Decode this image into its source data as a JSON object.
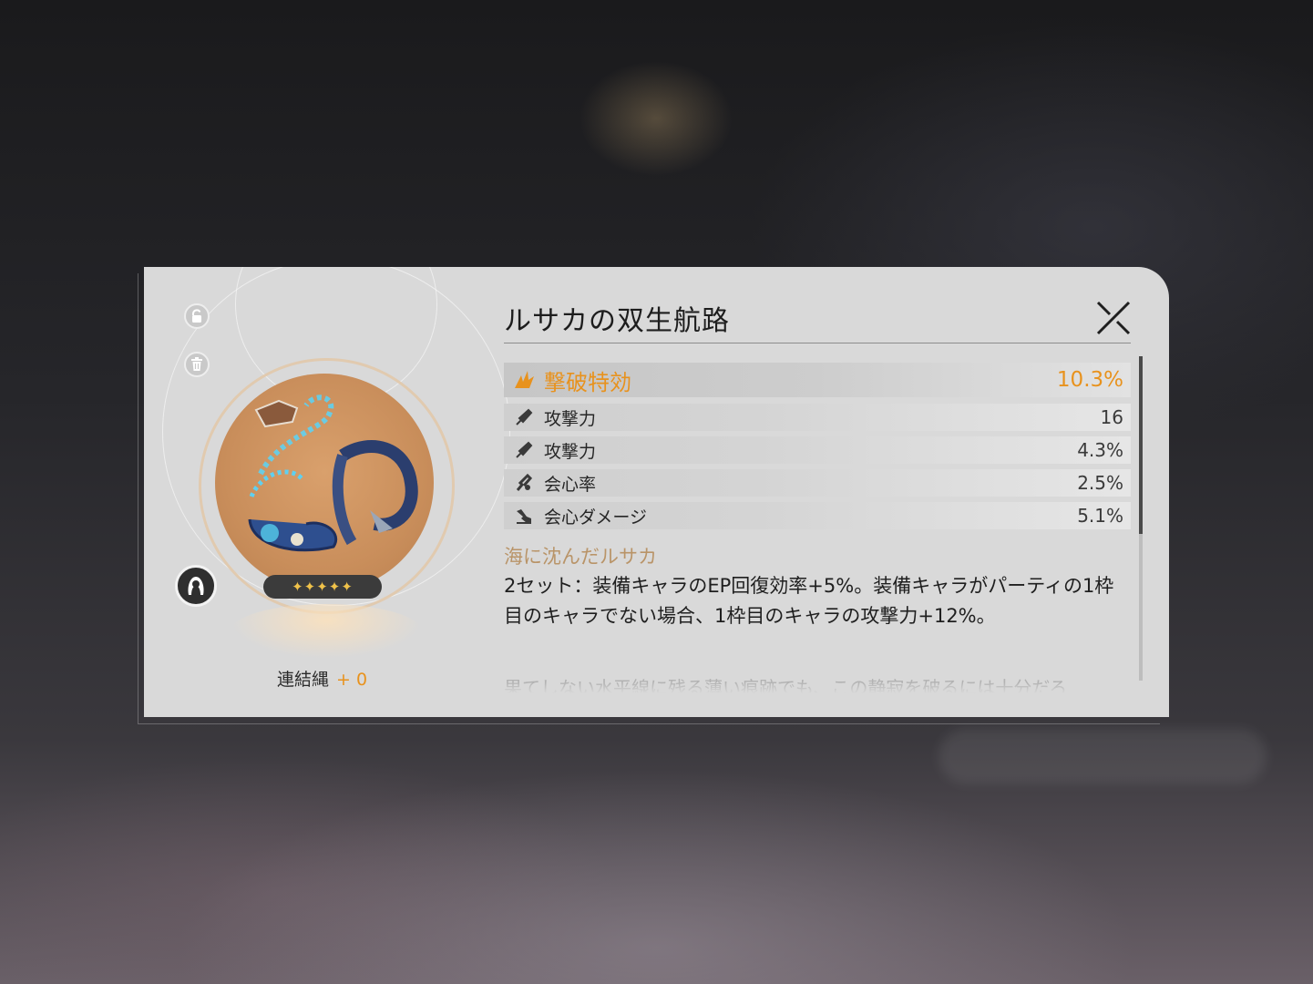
{
  "relic": {
    "name": "ルサカの双生航路",
    "rarity_stars": "✦✦✦✦✦",
    "bond_label": "連結縄",
    "bond_value": "+ 0"
  },
  "main_stat": {
    "icon": "break-effect-icon",
    "name": "撃破特効",
    "value": "10.3%"
  },
  "sub_stats": [
    {
      "icon": "atk-icon",
      "name": "攻撃力",
      "value": "16"
    },
    {
      "icon": "atk-icon",
      "name": "攻撃力",
      "value": "4.3%"
    },
    {
      "icon": "crit-rate-icon",
      "name": "会心率",
      "value": "2.5%"
    },
    {
      "icon": "crit-dmg-icon",
      "name": "会心ダメージ",
      "value": "5.1%"
    }
  ],
  "set": {
    "name": "海に沈んだルサカ",
    "description": "2セット：装備キャラのEP回復効率+5%。装備キャラがパーティの1枠目のキャラでない場合、1枠目のキャラの攻撃力+12%。",
    "flavor": "果てしない水平線に残る薄い痕跡でも、この静寂を破るには十分だろ"
  },
  "colors": {
    "accent": "#e8921d",
    "panel": "#d9d9d9",
    "set_name": "#b99468"
  }
}
